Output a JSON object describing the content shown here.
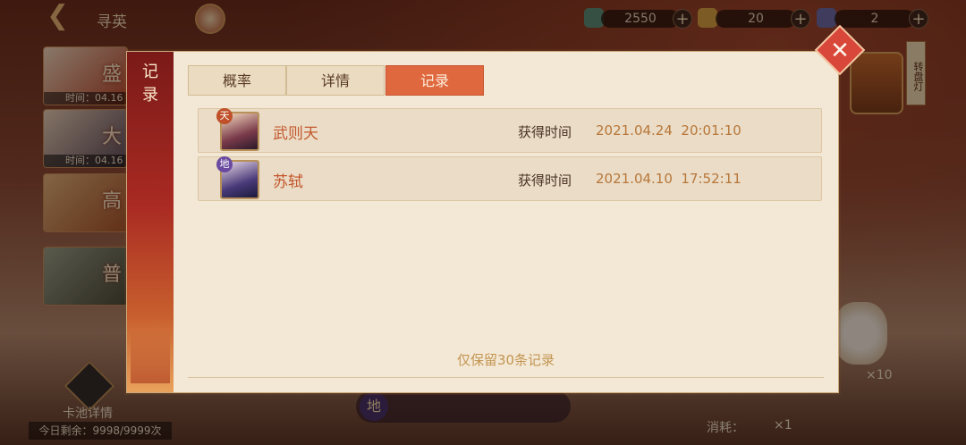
{
  "header": {
    "back_glyph": "❮",
    "title": "寻英"
  },
  "resources": [
    {
      "name": "jade-currency",
      "value": "2550",
      "color": "#5c8f7a"
    },
    {
      "name": "gold-ingot",
      "value": "20",
      "color": "#d9a441"
    },
    {
      "name": "cat-token",
      "value": "2",
      "color": "#6a6aa8"
    }
  ],
  "events": [
    {
      "label": "盛",
      "time": "时间：04.16"
    },
    {
      "label": "大",
      "time": "时间：04.16"
    },
    {
      "label": "高",
      "time": ""
    },
    {
      "label": "普",
      "time": ""
    }
  ],
  "pool_detail_label": "卡池详情",
  "today_remaining": "今日剩余：9998/9999次",
  "bottom_banner": {
    "badge": "地",
    "text": ""
  },
  "cost_label": "消耗：",
  "cost_multiplier": "×1",
  "ten_multiplier": "×10",
  "lantern_tag": "转盘灯",
  "modal": {
    "side_title": "记录",
    "tabs": [
      {
        "label": "概率",
        "active": false
      },
      {
        "label": "详情",
        "active": false
      },
      {
        "label": "记录",
        "active": true
      }
    ],
    "records": [
      {
        "name": "武则天",
        "tier": "天",
        "tier_color": "#c0502a",
        "time_label": "获得时间",
        "time": "2021.04.24  20:01:10"
      },
      {
        "name": "苏轼",
        "tier": "地",
        "tier_color": "#6a4aa0",
        "time_label": "获得时间",
        "time": "2021.04.10  17:52:11"
      }
    ],
    "footnote": "仅保留30条记录"
  },
  "colors": {
    "accent": "#e0683f",
    "panel": "#f3e8d5",
    "name_text": "#c4582e",
    "time_text": "#b8773a"
  }
}
